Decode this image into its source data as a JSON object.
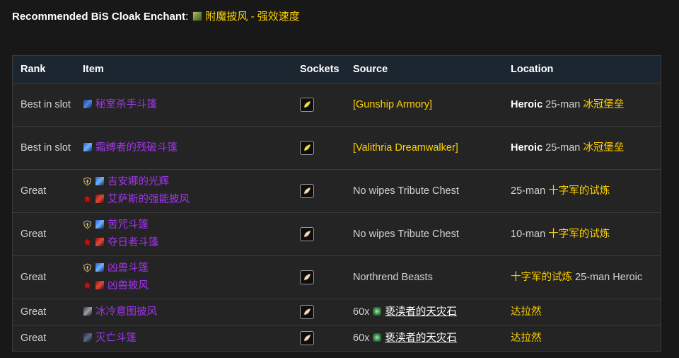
{
  "enchant": {
    "label": "Recommended BiS Cloak Enchant",
    "separator": ":",
    "icon": "enchant-scroll-icon",
    "name": "附魔披风 - 强效速度"
  },
  "table": {
    "headers": {
      "rank": "Rank",
      "item": "Item",
      "sockets": "Sockets",
      "source": "Source",
      "location": "Location"
    },
    "rows": [
      {
        "rank": "Best in slot",
        "items": [
          {
            "name": "秘室杀手斗篷",
            "icon": "cloak-icon",
            "faction": ""
          }
        ],
        "socket_color": "#f3e23a",
        "source": {
          "text": "[Gunship Armory]",
          "style": "link"
        },
        "location": {
          "difficulty": "Heroic",
          "size": "25-man",
          "zone": "冰冠堡垒"
        }
      },
      {
        "rank": "Best in slot",
        "items": [
          {
            "name": "霜缚者的残破斗篷",
            "icon": "cloak-icon",
            "faction": ""
          }
        ],
        "socket_color": "#f3e23a",
        "source": {
          "text": "[Valithria Dreamwalker]",
          "style": "link"
        },
        "location": {
          "difficulty": "Heroic",
          "size": "25-man",
          "zone": "冰冠堡垒"
        }
      },
      {
        "rank": "Great",
        "items": [
          {
            "name": "吉安娜的光辉",
            "icon": "cloak-icon",
            "faction": "alliance-icon"
          },
          {
            "name": "艾萨斯的强能披风",
            "icon": "cloak-icon",
            "faction": "horde-icon"
          }
        ],
        "socket_color": "#f4dcc0",
        "source": {
          "text": "No wipes Tribute Chest",
          "style": "plain"
        },
        "location": {
          "size": "25-man",
          "zone": "十字军的试炼"
        }
      },
      {
        "rank": "Great",
        "items": [
          {
            "name": "苦咒斗篷",
            "icon": "cloak-icon",
            "faction": "alliance-icon"
          },
          {
            "name": "夺日者斗篷",
            "icon": "cloak-icon",
            "faction": "horde-icon"
          }
        ],
        "socket_color": "#f4dcc0",
        "source": {
          "text": "No wipes Tribute Chest",
          "style": "plain"
        },
        "location": {
          "size": "10-man",
          "zone": "十字军的试炼"
        }
      },
      {
        "rank": "Great",
        "items": [
          {
            "name": "凶兽斗篷",
            "icon": "cloak-icon",
            "faction": "alliance-icon"
          },
          {
            "name": "凶兽披风",
            "icon": "cloak-icon",
            "faction": "horde-icon"
          }
        ],
        "socket_color": "#f4dcc0",
        "source": {
          "text": "Northrend Beasts",
          "style": "plain"
        },
        "location": {
          "zone": "十字军的试炼",
          "size": "25-man",
          "difficulty": "Heroic"
        }
      },
      {
        "rank": "Great",
        "items": [
          {
            "name": "冰冷意图披风",
            "icon": "cloak-icon",
            "faction": ""
          }
        ],
        "socket_color": "#f4dcc0",
        "source": {
          "quantity": "60x",
          "currency": "亵渎者的天灾石",
          "currency_icon": "stone-icon"
        },
        "location": {
          "zone": "达拉然"
        }
      },
      {
        "rank": "Great",
        "items": [
          {
            "name": "灭亡斗篷",
            "icon": "cloak-icon",
            "faction": ""
          }
        ],
        "socket_color": "#f4dcc0",
        "source": {
          "quantity": "60x",
          "currency": "亵渎者的天灾石",
          "currency_icon": "stone-icon"
        },
        "location": {
          "zone": "达拉然"
        }
      }
    ]
  },
  "colors": {
    "epic": "#a335ee",
    "link": "#ffd100",
    "header_bg": "#1c2630",
    "row_bg": "#242424",
    "page_bg": "#181818"
  }
}
